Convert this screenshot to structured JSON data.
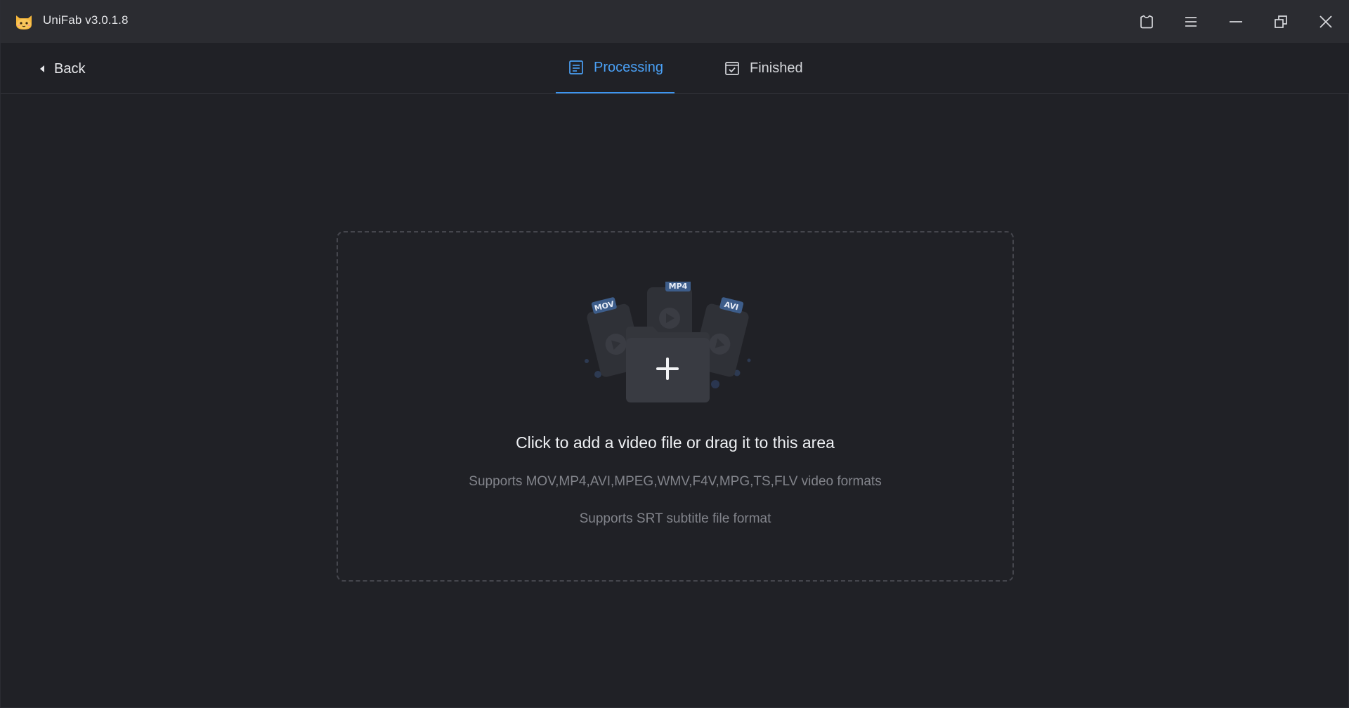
{
  "titlebar": {
    "title": "UniFab v3.0.1.8",
    "logo_icon": "cat-logo-icon",
    "buttons": [
      "skin-icon",
      "menu-icon",
      "minimize-icon",
      "restore-icon",
      "close-icon"
    ]
  },
  "nav": {
    "back_label": "Back",
    "tabs": [
      {
        "label": "Processing",
        "icon": "list-doc-icon",
        "active": true
      },
      {
        "label": "Finished",
        "icon": "checkbox-icon",
        "active": false
      }
    ]
  },
  "dropzone": {
    "badges": {
      "mov": "MOV",
      "mp4": "MP4",
      "avi": "AVI"
    },
    "title": "Click to add a video file or drag it to this area",
    "video_formats": "Supports MOV,MP4,AVI,MPEG,WMV,F4V,MPG,TS,FLV video formats",
    "subtitle_formats": "Supports SRT subtitle file format"
  },
  "colors": {
    "accent": "#3d95f0",
    "background": "#202126",
    "titlebar": "#2b2c31"
  }
}
